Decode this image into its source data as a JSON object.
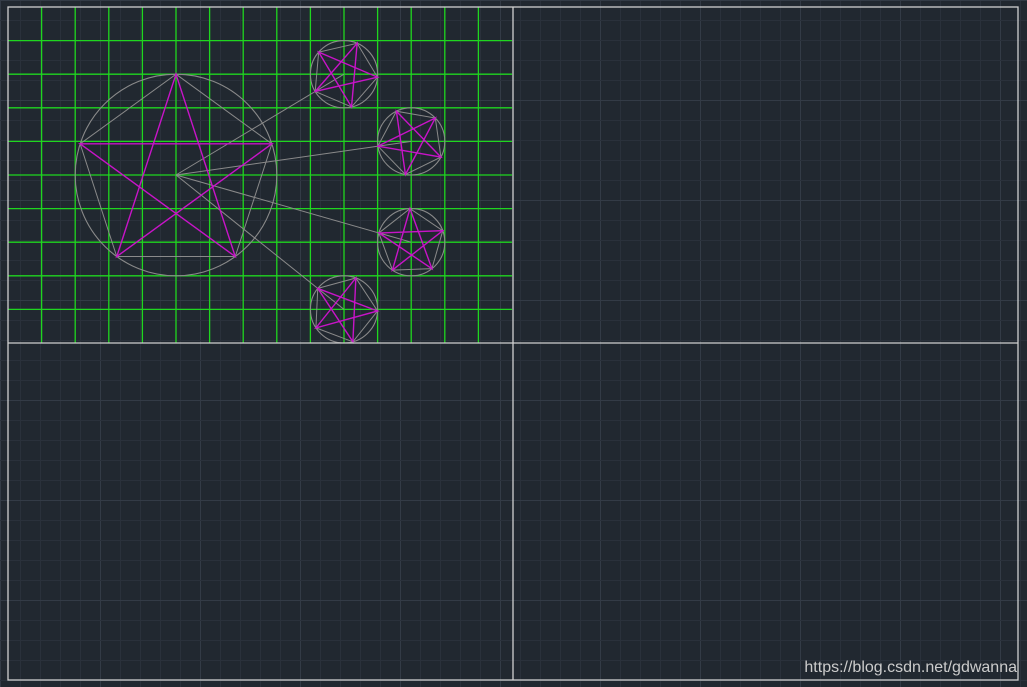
{
  "canvas": {
    "background_color": "#212830",
    "minor_grid_color": "#2a313b",
    "major_grid_color": "#333b46"
  },
  "drawing": {
    "frame_color": "#d0d0d0",
    "construction_grid_color": "#1fd61f",
    "construction_circle_color": "#8a8a8a",
    "star_color": "#c814c8",
    "construction_grid": {
      "columns": 15,
      "rows": 10
    },
    "large_star": {
      "center": [
        5,
        5
      ],
      "radius": 3
    },
    "small_stars": [
      {
        "center": [
          10,
          2
        ],
        "radius": 1
      },
      {
        "center": [
          12,
          4
        ],
        "radius": 1
      },
      {
        "center": [
          12,
          7
        ],
        "radius": 1
      },
      {
        "center": [
          10,
          9
        ],
        "radius": 1
      }
    ]
  },
  "watermark": {
    "text": "https://blog.csdn.net/gdwanna",
    "color": "#cccccc"
  }
}
